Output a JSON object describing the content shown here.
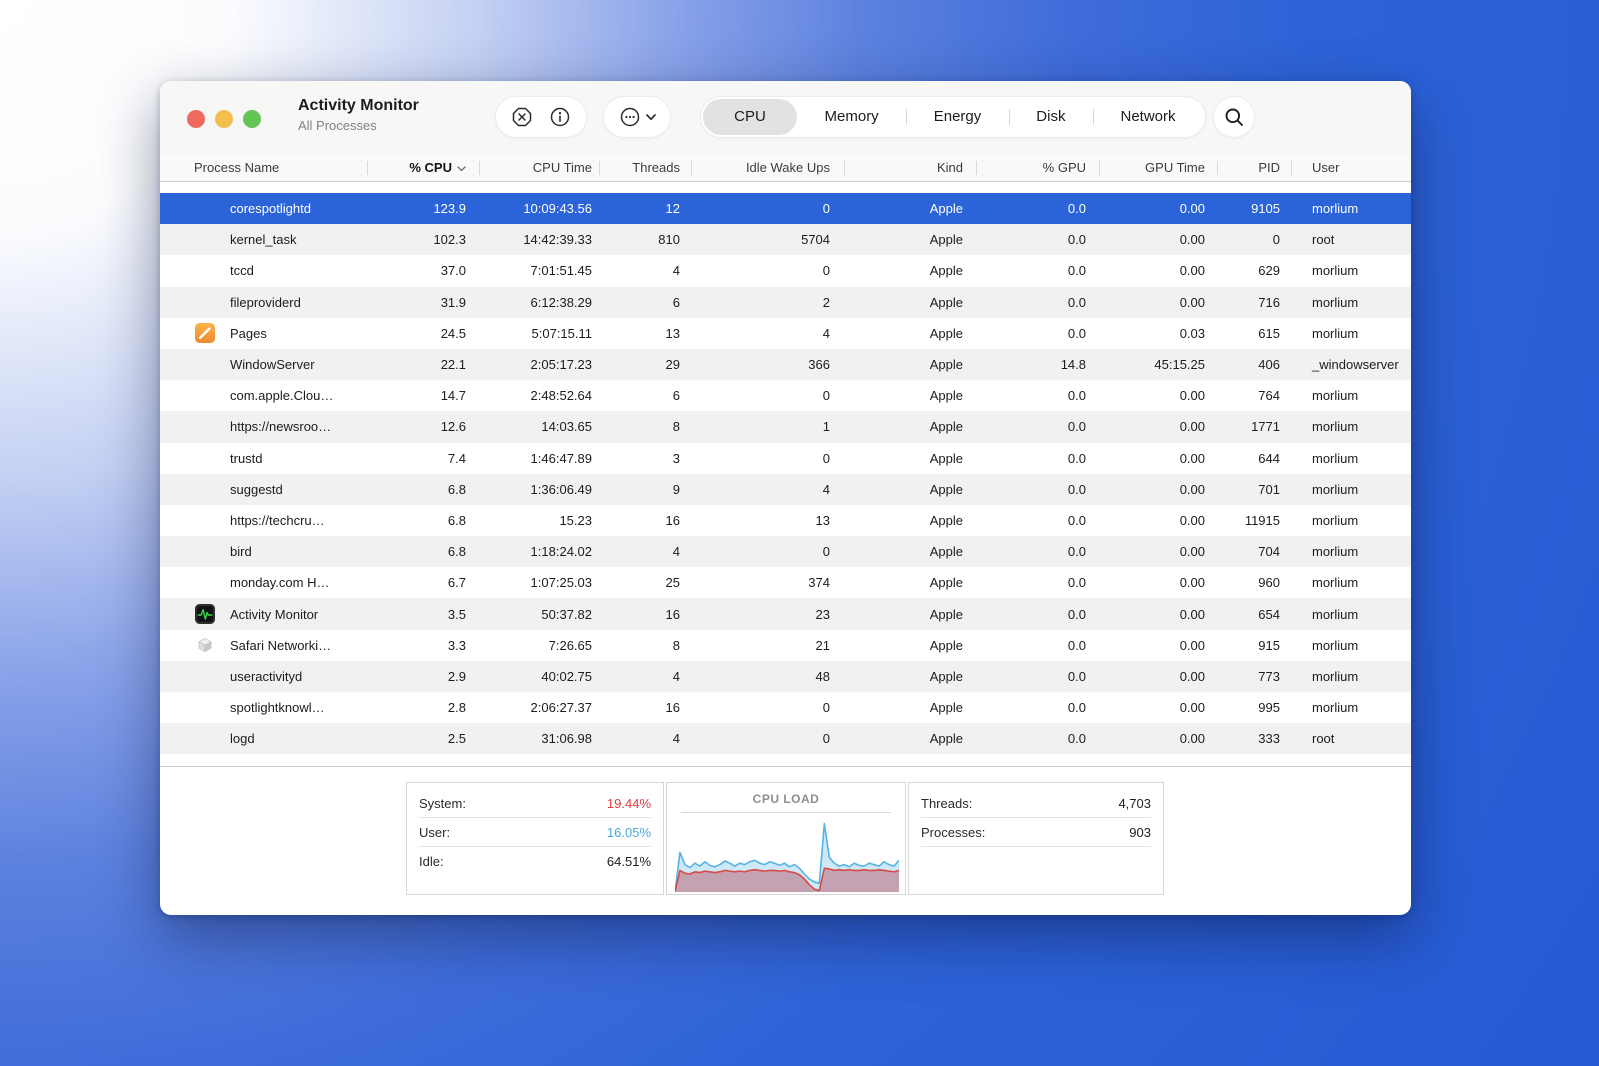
{
  "window": {
    "title": "Activity Monitor",
    "subtitle": "All Processes",
    "tabs": [
      {
        "label": "CPU",
        "selected": true
      },
      {
        "label": "Memory",
        "selected": false
      },
      {
        "label": "Energy",
        "selected": false
      },
      {
        "label": "Disk",
        "selected": false
      },
      {
        "label": "Network",
        "selected": false
      }
    ],
    "toolbar": {
      "stop_icon": "octagon-x-icon",
      "inspect_icon": "info-circle-icon",
      "options_icon": "ellipsis-circle-icon",
      "search_icon": "magnifier-icon"
    }
  },
  "table": {
    "sort_column": "cpu",
    "sort_direction": "desc",
    "columns": [
      {
        "key": "name",
        "label": "Process Name",
        "sorted": false
      },
      {
        "key": "cpu",
        "label": "% CPU",
        "sorted": true
      },
      {
        "key": "cpu_time",
        "label": "CPU Time",
        "sorted": false
      },
      {
        "key": "threads",
        "label": "Threads",
        "sorted": false
      },
      {
        "key": "idle_wake_ups",
        "label": "Idle Wake Ups",
        "sorted": false
      },
      {
        "key": "kind",
        "label": "Kind",
        "sorted": false
      },
      {
        "key": "gpu",
        "label": "% GPU",
        "sorted": false
      },
      {
        "key": "gpu_time",
        "label": "GPU Time",
        "sorted": false
      },
      {
        "key": "pid",
        "label": "PID",
        "sorted": false
      },
      {
        "key": "user",
        "label": "User",
        "sorted": false
      }
    ],
    "rows": [
      {
        "name": "corespotlightd",
        "icon": null,
        "cpu": "123.9",
        "cpu_time": "10:09:43.56",
        "threads": "12",
        "idle_wake_ups": "0",
        "kind": "Apple",
        "gpu": "0.0",
        "gpu_time": "0.00",
        "pid": "9105",
        "user": "morlium",
        "selected": true
      },
      {
        "name": "kernel_task",
        "icon": null,
        "cpu": "102.3",
        "cpu_time": "14:42:39.33",
        "threads": "810",
        "idle_wake_ups": "5704",
        "kind": "Apple",
        "gpu": "0.0",
        "gpu_time": "0.00",
        "pid": "0",
        "user": "root",
        "selected": false
      },
      {
        "name": "tccd",
        "icon": null,
        "cpu": "37.0",
        "cpu_time": "7:01:51.45",
        "threads": "4",
        "idle_wake_ups": "0",
        "kind": "Apple",
        "gpu": "0.0",
        "gpu_time": "0.00",
        "pid": "629",
        "user": "morlium",
        "selected": false
      },
      {
        "name": "fileproviderd",
        "icon": null,
        "cpu": "31.9",
        "cpu_time": "6:12:38.29",
        "threads": "6",
        "idle_wake_ups": "2",
        "kind": "Apple",
        "gpu": "0.0",
        "gpu_time": "0.00",
        "pid": "716",
        "user": "morlium",
        "selected": false
      },
      {
        "name": "Pages",
        "icon": "pages-icon",
        "cpu": "24.5",
        "cpu_time": "5:07:15.11",
        "threads": "13",
        "idle_wake_ups": "4",
        "kind": "Apple",
        "gpu": "0.0",
        "gpu_time": "0.03",
        "pid": "615",
        "user": "morlium",
        "selected": false
      },
      {
        "name": "WindowServer",
        "icon": null,
        "cpu": "22.1",
        "cpu_time": "2:05:17.23",
        "threads": "29",
        "idle_wake_ups": "366",
        "kind": "Apple",
        "gpu": "14.8",
        "gpu_time": "45:15.25",
        "pid": "406",
        "user": "_windowserver",
        "selected": false
      },
      {
        "name": "com.apple.Clou…",
        "icon": null,
        "cpu": "14.7",
        "cpu_time": "2:48:52.64",
        "threads": "6",
        "idle_wake_ups": "0",
        "kind": "Apple",
        "gpu": "0.0",
        "gpu_time": "0.00",
        "pid": "764",
        "user": "morlium",
        "selected": false
      },
      {
        "name": "https://newsroo…",
        "icon": null,
        "cpu": "12.6",
        "cpu_time": "14:03.65",
        "threads": "8",
        "idle_wake_ups": "1",
        "kind": "Apple",
        "gpu": "0.0",
        "gpu_time": "0.00",
        "pid": "1771",
        "user": "morlium",
        "selected": false
      },
      {
        "name": "trustd",
        "icon": null,
        "cpu": "7.4",
        "cpu_time": "1:46:47.89",
        "threads": "3",
        "idle_wake_ups": "0",
        "kind": "Apple",
        "gpu": "0.0",
        "gpu_time": "0.00",
        "pid": "644",
        "user": "morlium",
        "selected": false
      },
      {
        "name": "suggestd",
        "icon": null,
        "cpu": "6.8",
        "cpu_time": "1:36:06.49",
        "threads": "9",
        "idle_wake_ups": "4",
        "kind": "Apple",
        "gpu": "0.0",
        "gpu_time": "0.00",
        "pid": "701",
        "user": "morlium",
        "selected": false
      },
      {
        "name": "https://techcru…",
        "icon": null,
        "cpu": "6.8",
        "cpu_time": "15.23",
        "threads": "16",
        "idle_wake_ups": "13",
        "kind": "Apple",
        "gpu": "0.0",
        "gpu_time": "0.00",
        "pid": "11915",
        "user": "morlium",
        "selected": false
      },
      {
        "name": "bird",
        "icon": null,
        "cpu": "6.8",
        "cpu_time": "1:18:24.02",
        "threads": "4",
        "idle_wake_ups": "0",
        "kind": "Apple",
        "gpu": "0.0",
        "gpu_time": "0.00",
        "pid": "704",
        "user": "morlium",
        "selected": false
      },
      {
        "name": "monday.com H…",
        "icon": null,
        "cpu": "6.7",
        "cpu_time": "1:07:25.03",
        "threads": "25",
        "idle_wake_ups": "374",
        "kind": "Apple",
        "gpu": "0.0",
        "gpu_time": "0.00",
        "pid": "960",
        "user": "morlium",
        "selected": false
      },
      {
        "name": "Activity Monitor",
        "icon": "activity-monitor-icon",
        "cpu": "3.5",
        "cpu_time": "50:37.82",
        "threads": "16",
        "idle_wake_ups": "23",
        "kind": "Apple",
        "gpu": "0.0",
        "gpu_time": "0.00",
        "pid": "654",
        "user": "morlium",
        "selected": false
      },
      {
        "name": "Safari Networki…",
        "icon": "safari-networking-icon",
        "cpu": "3.3",
        "cpu_time": "7:26.65",
        "threads": "8",
        "idle_wake_ups": "21",
        "kind": "Apple",
        "gpu": "0.0",
        "gpu_time": "0.00",
        "pid": "915",
        "user": "morlium",
        "selected": false
      },
      {
        "name": "useractivityd",
        "icon": null,
        "cpu": "2.9",
        "cpu_time": "40:02.75",
        "threads": "4",
        "idle_wake_ups": "48",
        "kind": "Apple",
        "gpu": "0.0",
        "gpu_time": "0.00",
        "pid": "773",
        "user": "morlium",
        "selected": false
      },
      {
        "name": "spotlightknowl…",
        "icon": null,
        "cpu": "2.8",
        "cpu_time": "2:06:27.37",
        "threads": "16",
        "idle_wake_ups": "0",
        "kind": "Apple",
        "gpu": "0.0",
        "gpu_time": "0.00",
        "pid": "995",
        "user": "morlium",
        "selected": false
      },
      {
        "name": "logd",
        "icon": null,
        "cpu": "2.5",
        "cpu_time": "31:06.98",
        "threads": "4",
        "idle_wake_ups": "0",
        "kind": "Apple",
        "gpu": "0.0",
        "gpu_time": "0.00",
        "pid": "333",
        "user": "root",
        "selected": false
      }
    ]
  },
  "footer": {
    "left_stats": [
      {
        "label": "System:",
        "value": "19.44%",
        "color": "#e23c3f"
      },
      {
        "label": "User:",
        "value": "16.05%",
        "color": "#47a8e2"
      },
      {
        "label": "Idle:",
        "value": "64.51%"
      }
    ],
    "right_stats": [
      {
        "label": "Threads:",
        "value": "4,703"
      },
      {
        "label": "Processes:",
        "value": "903"
      }
    ],
    "chart": {
      "type": "area",
      "title": "CPU LOAD",
      "ylim": [
        0,
        100
      ],
      "series": {
        "total": [
          0,
          55,
          38,
          34,
          40,
          36,
          42,
          37,
          35,
          38,
          43,
          40,
          36,
          40,
          38,
          42,
          44,
          40,
          38,
          42,
          40,
          37,
          40,
          35,
          38,
          33,
          25,
          18,
          14,
          12,
          95,
          48,
          40,
          36,
          38,
          35,
          40,
          37,
          36,
          40,
          38,
          36,
          42,
          38,
          36,
          44
        ],
        "system": [
          0,
          30,
          26,
          25,
          28,
          27,
          29,
          28,
          27,
          28,
          30,
          29,
          28,
          29,
          28,
          30,
          31,
          30,
          29,
          30,
          30,
          29,
          30,
          28,
          27,
          24,
          18,
          10,
          4,
          2,
          33,
          32,
          30,
          31,
          30,
          31,
          30,
          30,
          31,
          30,
          30,
          31,
          30,
          29,
          28,
          30
        ]
      },
      "colors": {
        "total_line": "#58b2e6",
        "total_fill": "#cde8f7",
        "system_line": "#d84a46",
        "system_fill": "rgba(187,92,108,0.5)"
      }
    }
  },
  "colors": {
    "selection": "#2b63d8",
    "row_alt": "#f1f1f2",
    "tab_selected_bg": "#e2e2e4"
  }
}
